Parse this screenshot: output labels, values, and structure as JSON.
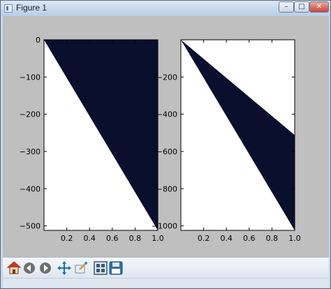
{
  "window": {
    "title": "Figure 1",
    "controls": {
      "minimize": "–",
      "maximize": "□",
      "close": "✕"
    }
  },
  "toolbar": {
    "icons": [
      "home-icon",
      "back-icon",
      "forward-icon",
      "pan-icon",
      "zoom-icon",
      "subplots-icon",
      "save-icon"
    ]
  },
  "colors": {
    "figure_background": "#bfbfbf",
    "fill": "#0b0f2e",
    "axes_background": "#ffffff"
  },
  "chart_data": [
    {
      "type": "area",
      "xlim": [
        0,
        1.0
      ],
      "ylim": [
        -512,
        0
      ],
      "xticks": [
        "0.2",
        "0.4",
        "0.6",
        "0.8",
        "1.0"
      ],
      "yticks": [
        "0",
        "−100",
        "−200",
        "−300",
        "−400",
        "−500"
      ],
      "xtick_values": [
        0.2,
        0.4,
        0.6,
        0.8,
        1.0
      ],
      "ytick_values": [
        0,
        -100,
        -200,
        -300,
        -400,
        -500
      ],
      "series": [
        {
          "x": [
            0,
            1.0
          ],
          "upper": [
            0,
            0
          ],
          "lower": [
            0,
            -512
          ]
        }
      ]
    },
    {
      "type": "area",
      "xlim": [
        0,
        1.0
      ],
      "ylim": [
        -1024,
        0
      ],
      "xticks": [
        "0.2",
        "0.4",
        "0.6",
        "0.8",
        "1.0"
      ],
      "yticks": [
        "−200",
        "−400",
        "−600",
        "−800",
        "−1000"
      ],
      "xtick_values": [
        0.2,
        0.4,
        0.6,
        0.8,
        1.0
      ],
      "ytick_values": [
        -200,
        -400,
        -600,
        -800,
        -1000
      ],
      "series": [
        {
          "x": [
            0,
            1.0
          ],
          "upper": [
            0,
            -512
          ],
          "lower": [
            0,
            -1024
          ]
        }
      ]
    }
  ]
}
